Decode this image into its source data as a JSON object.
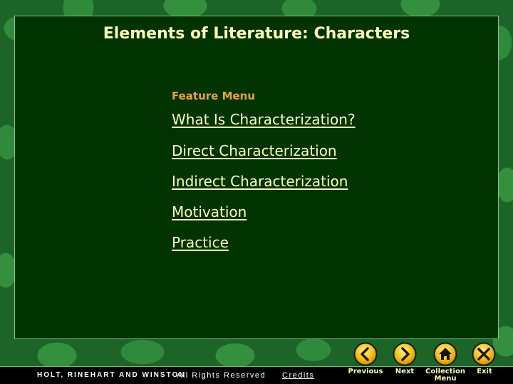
{
  "slide": {
    "title": "Elements of Literature: Characters",
    "feature_label": "Feature Menu",
    "menu_items": [
      {
        "label": "What Is Characterization?"
      },
      {
        "label": "Direct Characterization"
      },
      {
        "label": "Indirect Characterization"
      },
      {
        "label": "Motivation"
      },
      {
        "label": "Practice"
      }
    ]
  },
  "footer": {
    "publisher": "HOLT, RINEHART AND WINSTON",
    "rights": "All Rights Reserved",
    "credits": "Credits"
  },
  "nav": {
    "previous": {
      "label": "Previous",
      "icon": "chevron-left-icon"
    },
    "next": {
      "label": "Next",
      "icon": "chevron-right-icon"
    },
    "collection": {
      "label_line1": "Collection",
      "label_line2": "Menu",
      "icon": "home-icon"
    },
    "exit": {
      "label": "Exit",
      "icon": "close-icon"
    }
  },
  "colors": {
    "panel_bg": "#003300",
    "title_text": "#ffffb3",
    "feature_label": "#e8a040",
    "link_text": "#ffffb3",
    "button_gold": "#f5c518"
  }
}
